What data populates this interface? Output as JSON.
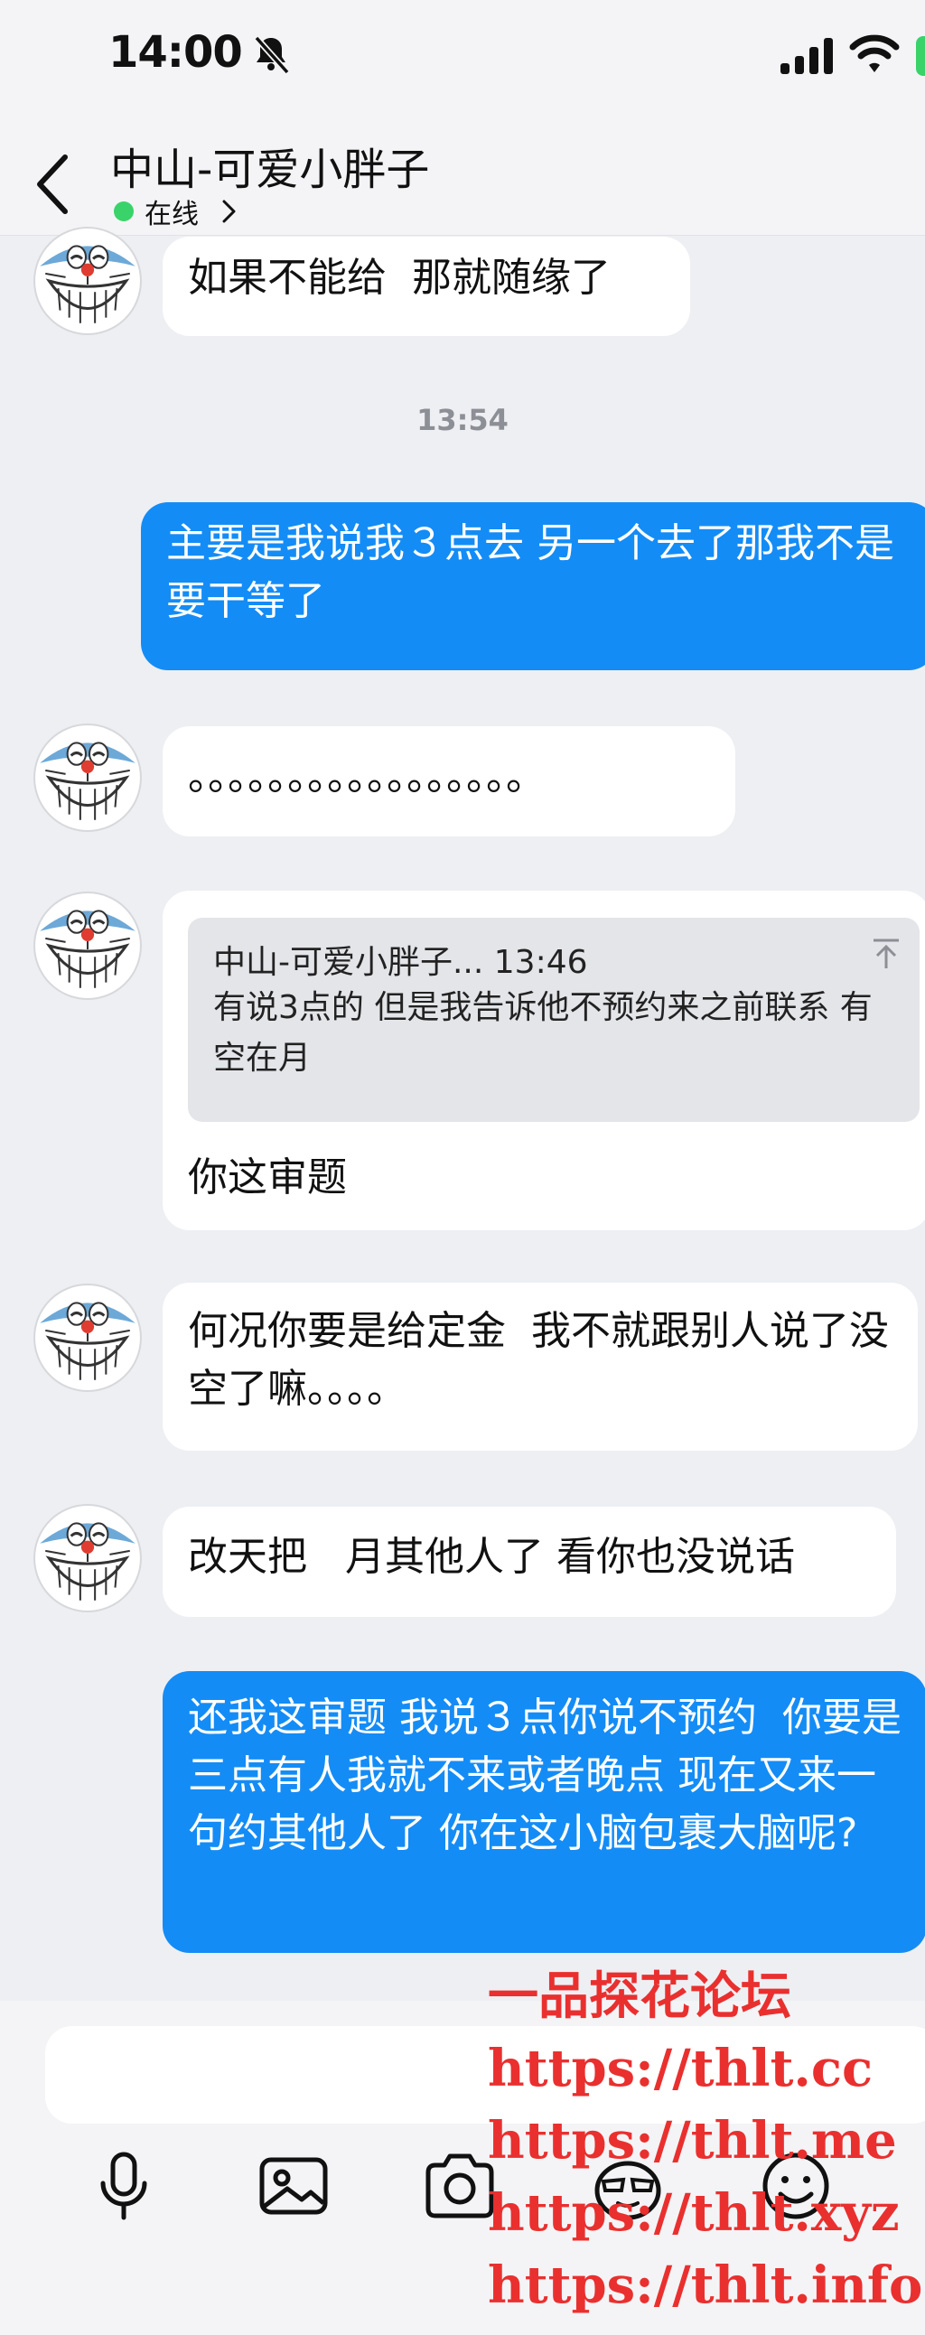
{
  "status_bar": {
    "time": "14:00"
  },
  "header": {
    "contact_name": "中山-可爱小胖子",
    "presence": "在线"
  },
  "messages": [
    {
      "side": "in",
      "text": "如果不能给  那就随缘了"
    },
    {
      "timestamp": "13:54"
    },
    {
      "side": "out",
      "text": "主要是我说我３点去 另一个去了那我不是要干等了"
    },
    {
      "side": "in",
      "text": "。。。。。。。。。。。。。。。。。"
    },
    {
      "side": "in",
      "quote": {
        "header": "中山-可爱小胖子... 13:46",
        "body": "有说3点的  但是我告诉他不预约来之前联系 有空在月"
      },
      "text": "你这审题"
    },
    {
      "side": "in",
      "text": "何况你要是给定金  我不就跟别人说了没空了嘛。。。。"
    },
    {
      "side": "in",
      "text": "改天把   月其他人了 看你也没说话"
    },
    {
      "side": "out",
      "text": "还我这审题 我说３点你说不预约  你要是三点有人我就不来或者晚点 现在又来一句约其他人了 你在这小脑包裹大脑呢?"
    }
  ],
  "input": {
    "placeholder": ""
  },
  "toolbar": [
    "microphone-icon",
    "image-icon",
    "camera-icon",
    "sticker-icon",
    "emoji-icon"
  ],
  "watermark": [
    "一品探花论坛",
    "https://thlt.cc",
    "https://thlt.me",
    "https://thlt.xyz",
    "https://thlt.info"
  ],
  "colors": {
    "outgoing_bubble": "#148cf6",
    "incoming_bubble": "#ffffff",
    "background": "#eeeff3",
    "online_dot": "#3ad36a",
    "watermark": "#e9302f"
  }
}
